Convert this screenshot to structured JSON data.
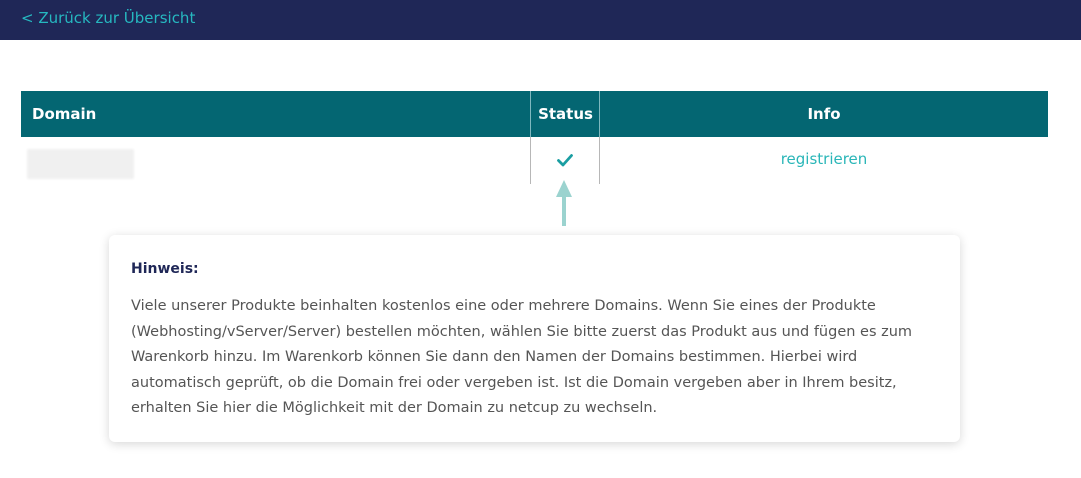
{
  "nav": {
    "back_link": "< Zurück zur Übersicht"
  },
  "table": {
    "columns": [
      "Domain",
      "Status",
      "Info"
    ],
    "rows": [
      {
        "domain": "",
        "status_icon": "checkmark-icon",
        "info": "registrieren"
      }
    ]
  },
  "notice": {
    "title": "Hinweis:",
    "body": "Viele unserer Produkte beinhalten kostenlos eine oder mehrere Domains. Wenn Sie eines der Produkte (Webhosting/vServer/Server) bestellen möchten, wählen Sie bitte zuerst das Produkt aus und fügen es zum Warenkorb hinzu. Im Warenkorb können Sie dann den Namen der Domains bestimmen. Hierbei wird automatisch geprüft, ob die Domain frei oder vergeben ist. Ist die Domain vergeben aber in Ihrem besitz, erhalten Sie hier die Möglichkeit mit der Domain zu netcup zu wechseln."
  },
  "colors": {
    "topbar": "#1f2757",
    "table_header": "#046672",
    "accent": "#2ab6b8",
    "arrow": "#9bd3cf"
  }
}
